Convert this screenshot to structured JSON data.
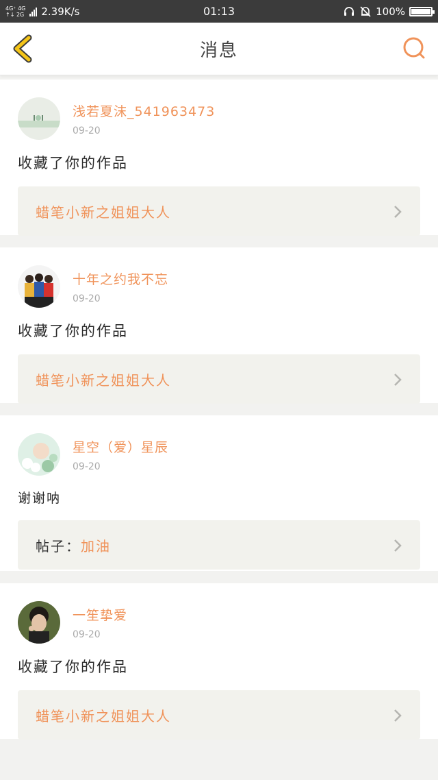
{
  "status_bar": {
    "net_top": "4G⁺ 4G",
    "net_bottom": "↑↓ 2G",
    "speed": "2.39K/s",
    "time": "01:13",
    "battery": "100%"
  },
  "header": {
    "title": "消息"
  },
  "notifications": [
    {
      "username": "浅若夏沫_541963473",
      "date": "09-20",
      "action": "收藏了你的作品",
      "target_prefix": "",
      "target_title": "蜡笔小新之姐姐大人",
      "avatar": "avatar-1"
    },
    {
      "username": "十年之约我不忘",
      "date": "09-20",
      "action": "收藏了你的作品",
      "target_prefix": "",
      "target_title": "蜡笔小新之姐姐大人",
      "avatar": "avatar-2"
    },
    {
      "username": "星空（爱）星辰",
      "date": "09-20",
      "action": "谢谢呐",
      "target_prefix": "帖子：",
      "target_title": "加油",
      "avatar": "avatar-3"
    },
    {
      "username": "一笙挚爱",
      "date": "09-20",
      "action": "收藏了你的作品",
      "target_prefix": "",
      "target_title": "蜡笔小新之姐姐大人",
      "avatar": "avatar-4"
    }
  ],
  "colors": {
    "accent": "#f0935a",
    "back_arrow": "#f5c518",
    "card_box": "#f2f2ed",
    "status_bar": "#3b3b3b"
  }
}
